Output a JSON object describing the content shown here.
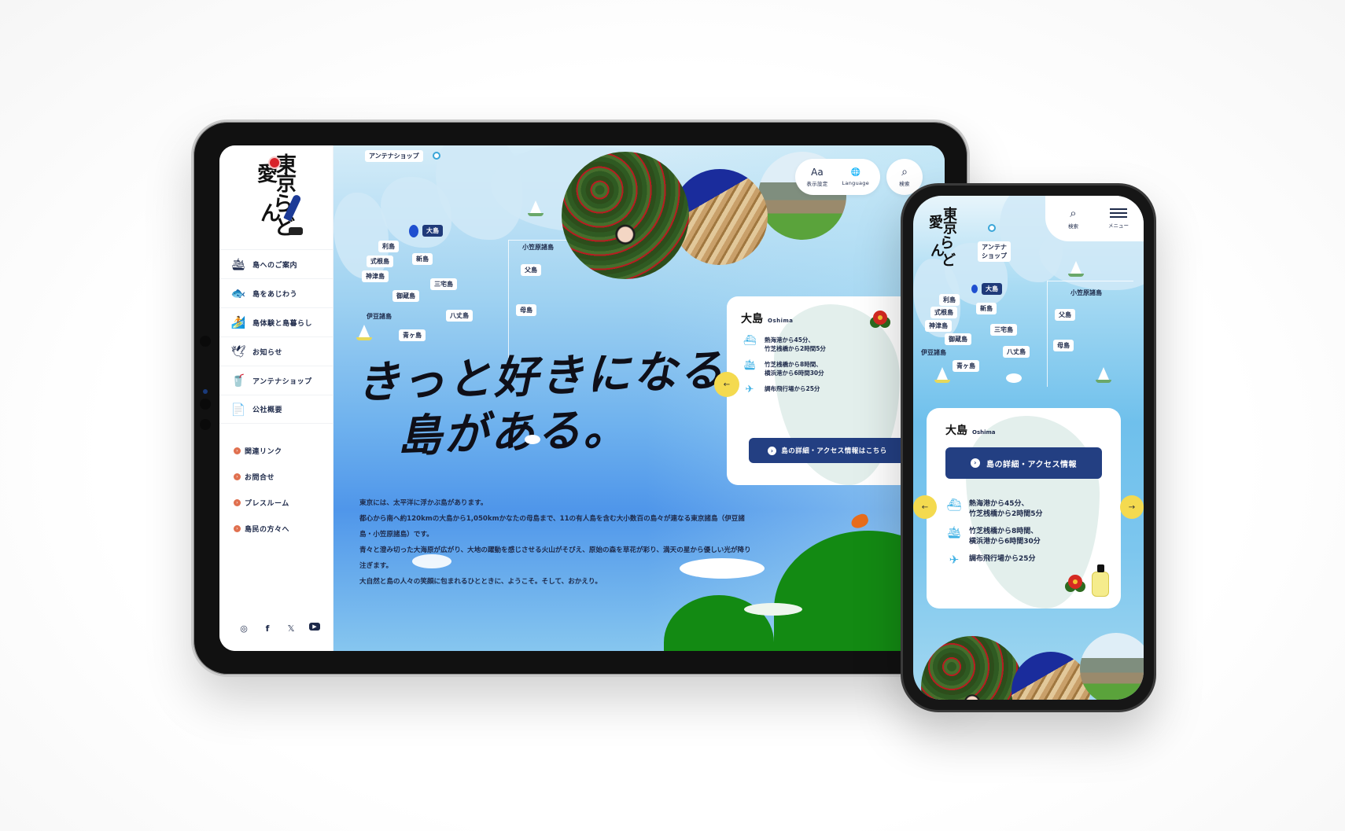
{
  "tablet": {
    "sidebar": {
      "logo_alt": "東京愛らんど",
      "logo_chars": [
        "東",
        "京",
        "愛",
        "ら",
        "ん",
        "ど"
      ],
      "nav_items": [
        {
          "label": "島へのご案内",
          "icon": "ferry-icon"
        },
        {
          "label": "島をあじわう",
          "icon": "fish-icon"
        },
        {
          "label": "島体験と島暮らし",
          "icon": "surfer-icon"
        },
        {
          "label": "お知らせ",
          "icon": "seagull-icon"
        },
        {
          "label": "アンテナショップ",
          "icon": "cup-icon"
        },
        {
          "label": "公社概要",
          "icon": "document-icon"
        }
      ],
      "sub_links": [
        {
          "label": "関連リンク"
        },
        {
          "label": "お問合せ"
        },
        {
          "label": "プレスルーム"
        },
        {
          "label": "島民の方々へ"
        }
      ],
      "social": [
        {
          "name": "instagram",
          "glyph": "◎"
        },
        {
          "name": "facebook",
          "glyph": "f"
        },
        {
          "name": "x",
          "glyph": "𝕏"
        },
        {
          "name": "youtube",
          "glyph": "▶"
        }
      ]
    },
    "header": {
      "display_settings": {
        "icon": "Aa",
        "label": "表示設定"
      },
      "language": {
        "icon": "🌐",
        "label": "Language"
      },
      "search": {
        "icon": "⌕",
        "label": "検索"
      }
    },
    "map": {
      "antenna_shop": "アンテナショップ",
      "izu_group": "伊豆諸島",
      "ogasawara_group": "小笠原諸島",
      "islands": {
        "oshima": "大島",
        "toshima": "利島",
        "niijima": "新島",
        "shikinejima": "式根島",
        "kozushima": "神津島",
        "miyakejima": "三宅島",
        "mikurajima": "御蔵島",
        "hachijojima": "八丈島",
        "aogashima": "青ヶ島",
        "chichijima": "父島",
        "hahajima": "母島"
      }
    },
    "headline": {
      "line1": "きっと好きになる、",
      "line2": "島がある。"
    },
    "intro": [
      "東京には、太平洋に浮かぶ島があります。",
      "都心から南へ約120kmの大島から1,050kmかなたの母島まで、11の有人島を含む大小数百の島々が連なる東京諸島（伊豆諸島・小笠原諸島）です。",
      "青々と澄み切った大海原が広がり、大地の躍動を感じさせる火山がそびえ、原始の森を草花が彩り、満天の星から優しい光が降り注ぎます。",
      "大自然と島の人々の笑顔に包まれるひとときに、ようこそ。そして、おかえり。"
    ],
    "island_card": {
      "name_jp": "大島",
      "name_en": "Oshima",
      "access": [
        {
          "icon": "speedboat-icon",
          "glyph": "⛴",
          "text": "熱海港から45分、\n竹芝桟橋から2時間5分"
        },
        {
          "icon": "ship-icon",
          "glyph": "🛳",
          "text": "竹芝桟橋から8時間、\n横浜港から6時間30分"
        },
        {
          "icon": "airplane-icon",
          "glyph": "✈",
          "text": "調布飛行場から25分"
        }
      ],
      "cta": "島の詳細・アクセス情報はこちら",
      "prev_arrow": "←"
    }
  },
  "phone": {
    "header": {
      "search": {
        "icon": "⌕",
        "label": "検索"
      },
      "menu": {
        "label": "メニュー"
      }
    },
    "map": {
      "antenna_shop": "アンテナ\nショップ",
      "izu_group": "伊豆諸島",
      "ogasawara_group": "小笠原諸島"
    },
    "island_card": {
      "name_jp": "大島",
      "name_en": "Oshima",
      "cta": "島の詳細・アクセス情報",
      "prev_arrow": "←",
      "next_arrow": "→"
    }
  },
  "colors": {
    "navy": "#233f82",
    "accent_orange": "#e0704f",
    "arrow_yellow": "#f4da4f",
    "sky_blue": "#6fb2ee",
    "access_icon_blue": "#3db0e4"
  }
}
